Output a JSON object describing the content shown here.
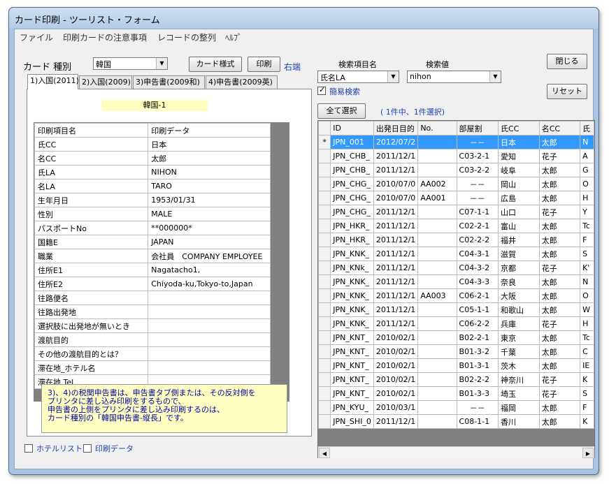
{
  "window": {
    "title": "カード印刷 - ツーリスト・フォーム"
  },
  "menu": [
    "ファイル",
    "印刷カードの注意事項",
    "レコードの整列",
    "ﾍﾙﾌﾟ"
  ],
  "card_type": {
    "label": "カード 種別",
    "value": "韓国"
  },
  "buttons": {
    "card_style": "カード様式",
    "print": "印刷",
    "close": "閉じる",
    "reset": "リセット",
    "select_all": "全て選択"
  },
  "right_end_label": "右端",
  "search": {
    "field_label": "検索項目名",
    "field_value": "氏名LA",
    "value_label": "検索値",
    "value": "nihon",
    "simple_label": "簡易検索"
  },
  "selection_status": "( 1件中、1件選択)",
  "tabs": [
    "1)入国(2011)",
    "2)入国(2009)",
    "3)申告書(2009和)",
    "4)申告書(2009英)"
  ],
  "card_header": "韓国-1",
  "props": {
    "headers": [
      "印刷項目名",
      "印刷データ"
    ],
    "rows": [
      [
        "氏CC",
        "日本"
      ],
      [
        "名CC",
        "太郎"
      ],
      [
        "氏LA",
        "NIHON"
      ],
      [
        "名LA",
        "TARO"
      ],
      [
        "生年月日",
        "1953/01/31"
      ],
      [
        "性別",
        "MALE"
      ],
      [
        "パスポートNo",
        "**000000*"
      ],
      [
        "国籍E",
        "JAPAN"
      ],
      [
        "職業",
        "会社員　COMPANY EMPLOYEE"
      ],
      [
        "住所E1",
        "Nagatacho1,"
      ],
      [
        "住所E2",
        "Chiyoda-ku,Tokyo-to,Japan"
      ],
      [
        "往路便名",
        ""
      ],
      [
        "往路出発地",
        ""
      ],
      [
        "選択肢に出発地が無いとき",
        ""
      ],
      [
        "渡航目的",
        ""
      ],
      [
        "その他の渡航目的とは？",
        ""
      ],
      [
        "滞在地_ホテル名",
        ""
      ],
      [
        "滞在地 Tel",
        ""
      ]
    ]
  },
  "note_lines": [
    "3)、4)の税関申告書は、申告書タブ側または、その反対側を",
    "プリンタに差し込み印刷をするもので、",
    "申告書の上側をプリンタに差し込み印刷するのは、",
    "カード種別の「韓国申告書-縦長」です。"
  ],
  "bottom_checks": {
    "hotel_list": "ホテルリスト",
    "print_data": "印刷データ"
  },
  "records": {
    "headers": [
      "ID",
      "出発日目的",
      "No.",
      "部屋割",
      "氏CC",
      "名CC",
      "氏"
    ],
    "current_marker": "*",
    "rows": [
      [
        "JPN_001",
        "2012/07/2",
        "",
        "－－",
        "日本",
        "太郎",
        "N"
      ],
      [
        "JPN_CHB_",
        "2011/12/1",
        "",
        "C03-2-1",
        "愛知",
        "花子",
        "A"
      ],
      [
        "JPN_CHB_",
        "2011/12/1",
        "",
        "C03-2-2",
        "岐阜",
        "太郎",
        "G"
      ],
      [
        "JPN_CHG_",
        "2010/07/0",
        "AA002",
        "－－",
        "岡山",
        "太郎",
        "O"
      ],
      [
        "JPN_CHG_",
        "2010/07/0",
        "AA001",
        "－－",
        "広島",
        "太郎",
        "H"
      ],
      [
        "JPN_CHG_",
        "2011/12/1",
        "",
        "C07-1-1",
        "山口",
        "花子",
        "Y"
      ],
      [
        "JPN_HKR_",
        "2011/12/1",
        "",
        "C02-2-1",
        "富山",
        "太郎",
        "Tc"
      ],
      [
        "JPN_HKR_",
        "2011/12/1",
        "",
        "C02-2-2",
        "福井",
        "太郎",
        "F"
      ],
      [
        "JPN_KNK_",
        "2011/12/1",
        "",
        "C04-3-1",
        "滋賀",
        "太郎",
        "S"
      ],
      [
        "JPN_KNk_",
        "2011/12/1",
        "",
        "C04-3-2",
        "京都",
        "花子",
        "K'"
      ],
      [
        "JPN_KNK_",
        "2011/12/1",
        "",
        "C04-3-3",
        "奈良",
        "太郎",
        "N"
      ],
      [
        "JPN_KNK_",
        "2011/12/1",
        "AA003",
        "C06-2-1",
        "大阪",
        "太郎",
        "O"
      ],
      [
        "JPN_KNK_",
        "2011/12/1",
        "",
        "C05-1-1",
        "和歌山",
        "太郎",
        "W"
      ],
      [
        "JPN_KNK_",
        "2011/12/1",
        "",
        "C06-2-2",
        "兵庫",
        "花子",
        "H"
      ],
      [
        "JPN_KNT_",
        "2010/02/1",
        "",
        "B02-2-1",
        "東京",
        "太郎",
        "Tc"
      ],
      [
        "JPN_KNT_",
        "2010/02/1",
        "",
        "B01-3-2",
        "千葉",
        "太郎",
        "C"
      ],
      [
        "JPN_KNT_",
        "2010/02/1",
        "",
        "B01-3-1",
        "茨木",
        "太郎",
        "IE"
      ],
      [
        "JPN_KNT_",
        "2010/02/1",
        "",
        "B02-2-2",
        "神奈川",
        "花子",
        "K"
      ],
      [
        "JPN_KNT_",
        "2010/02/1",
        "",
        "B01-3-3",
        "埼玉",
        "花子",
        "S"
      ],
      [
        "JPN_KYU_",
        "2010/03/1",
        "",
        "－－",
        "福岡",
        "太郎",
        "F"
      ],
      [
        "JPN_SHI_0",
        "2011/12/1",
        "",
        "C08-1-1",
        "香川",
        "太郎",
        "K"
      ]
    ]
  },
  "colors": {
    "selection": "#3399ff",
    "note_bg": "#ffffc4",
    "card_header_bg": "#ffffc0"
  }
}
